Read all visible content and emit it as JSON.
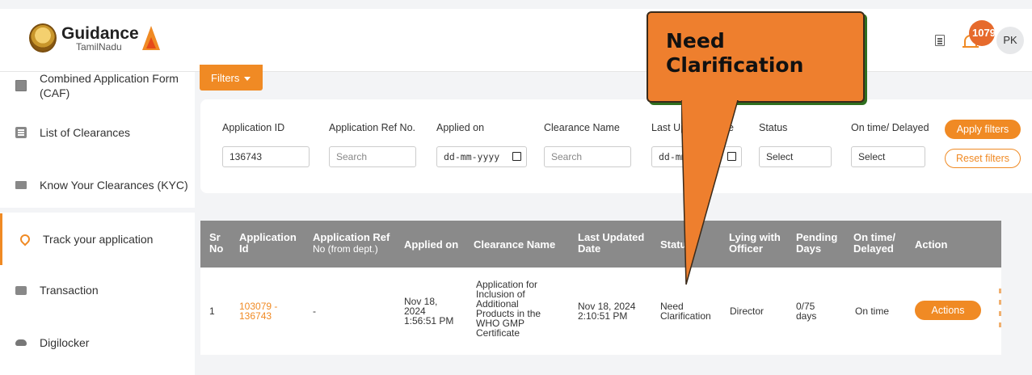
{
  "header": {
    "logo_title": "Guidance",
    "logo_subtitle": "TamilNadu",
    "notification_count": "1079",
    "avatar_initials": "PK"
  },
  "sidebar": {
    "items": [
      {
        "label": "Combined Application Form (CAF)",
        "icon": "document-icon"
      },
      {
        "label": "List of Clearances",
        "icon": "list-icon"
      },
      {
        "label": "Know Your Clearances (KYC)",
        "icon": "book-icon"
      },
      {
        "label": "Track your application",
        "icon": "location-pin-icon"
      },
      {
        "label": "Transaction",
        "icon": "card-icon"
      },
      {
        "label": "Digilocker",
        "icon": "cloud-icon"
      }
    ]
  },
  "filters": {
    "toggle_label": "Filters",
    "application_id": {
      "label": "Application ID",
      "value": "136743"
    },
    "application_ref": {
      "label": "Application Ref No.",
      "placeholder": "Search"
    },
    "applied_on": {
      "label": "Applied on",
      "placeholder": "dd-mm-yyyy"
    },
    "clearance_name": {
      "label": "Clearance Name",
      "placeholder": "Search"
    },
    "last_updated": {
      "label": "Last Up",
      "label_tail": "e",
      "placeholder": "dd-mm"
    },
    "status": {
      "label": "Status",
      "value": "Select"
    },
    "on_time": {
      "label": "On time/ Delayed",
      "value": "Select"
    },
    "apply_label": "Apply filters",
    "reset_label": "Reset filters"
  },
  "table": {
    "headers": {
      "sr": [
        "Sr",
        "No"
      ],
      "app_id": [
        "Application",
        "Id"
      ],
      "ref": [
        "Application Ref",
        "No (from dept.)"
      ],
      "applied": "Applied on",
      "clearance": "Clearance Name",
      "updated": [
        "Last Updated",
        "Date"
      ],
      "status": "Statu",
      "lying": [
        "Lying with",
        "Officer"
      ],
      "pending": [
        "Pending",
        "Days"
      ],
      "ontime": [
        "On time/",
        "Delayed"
      ],
      "action": "Action"
    },
    "row": {
      "sr": "1",
      "app_id": [
        "103079 -",
        "136743"
      ],
      "ref": "-",
      "applied": [
        "Nov 18,",
        "2024",
        "1:56:51 PM"
      ],
      "clearance": [
        "Application for",
        "Inclusion of",
        "Additional",
        "Products in the",
        "WHO GMP",
        "Certificate"
      ],
      "updated": [
        "Nov 18, 2024",
        "2:10:51 PM"
      ],
      "status": [
        "Need",
        "Clarification"
      ],
      "lying": "Director",
      "pending": [
        "0/75",
        "days"
      ],
      "ontime": "On time",
      "action_label": "Actions"
    }
  },
  "callout": {
    "lines": [
      "Need",
      "Clarification"
    ]
  },
  "colors": {
    "accent": "#f08a24",
    "callout": "#ee7f2e",
    "table_header": "#8a8a8a"
  }
}
